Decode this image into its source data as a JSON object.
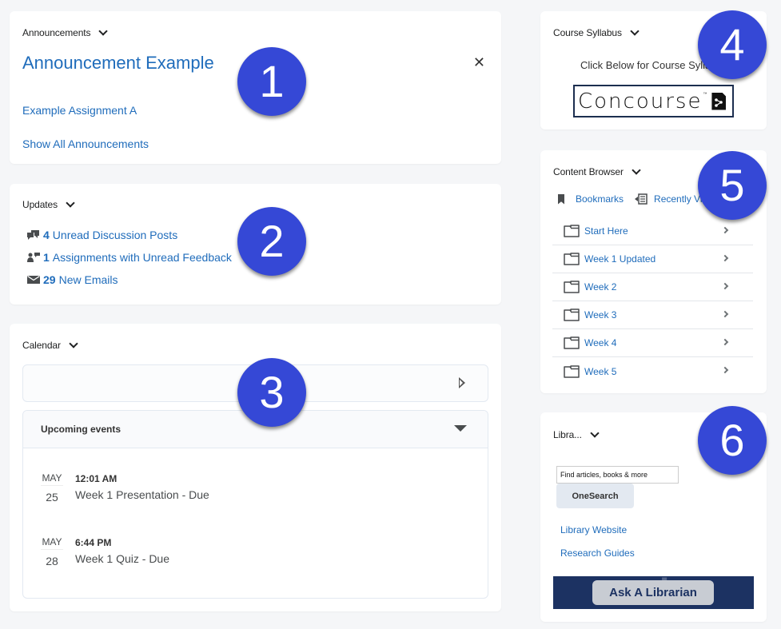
{
  "announcements": {
    "header": "Announcements",
    "title": "Announcement Example",
    "close_icon": "close-icon",
    "links": [
      "Example Assignment A",
      "Show All Announcements"
    ]
  },
  "updates": {
    "header": "Updates",
    "items": [
      {
        "icon": "discussion-icon",
        "count": "4",
        "label": "Unread Discussion Posts"
      },
      {
        "icon": "feedback-icon",
        "count": "1",
        "label": "Assignments with Unread Feedback"
      },
      {
        "icon": "email-icon",
        "count": "29",
        "label": "New Emails"
      }
    ]
  },
  "calendar": {
    "header": "Calendar",
    "upcoming_label": "Upcoming events",
    "events": [
      {
        "month": "MAY",
        "day": "25",
        "time": "12:01 AM",
        "name": "Week 1 Presentation - Due"
      },
      {
        "month": "MAY",
        "day": "28",
        "time": "6:44 PM",
        "name": "Week 1 Quiz - Due"
      }
    ]
  },
  "syllabus": {
    "header": "Course Syllabus",
    "text": "Click Below for Course Syllabus",
    "logo_text": "Concourse",
    "logo_tm": "™"
  },
  "content_browser": {
    "header": "Content Browser",
    "tabs": [
      {
        "icon": "bookmark-icon",
        "label": "Bookmarks"
      },
      {
        "icon": "recently-viewed-icon",
        "label": "Recently Viewed"
      }
    ],
    "items": [
      "Start Here",
      "Week 1 Updated",
      "Week 2",
      "Week 3",
      "Week 4",
      "Week 5"
    ]
  },
  "library": {
    "header": "Libra...",
    "search_value": "Find articles, books & more",
    "search_button": "OneSearch",
    "links": [
      "Library Website",
      "Research Guides"
    ],
    "banner_text": "Ask A Librarian",
    "banner_bg_text": "ask"
  },
  "badges": [
    "1",
    "2",
    "3",
    "4",
    "5",
    "6"
  ],
  "colors": {
    "link": "#1f6cbb",
    "badge": "#3548d6",
    "banner": "#1c3262",
    "page_bg": "#f5f6f8"
  }
}
